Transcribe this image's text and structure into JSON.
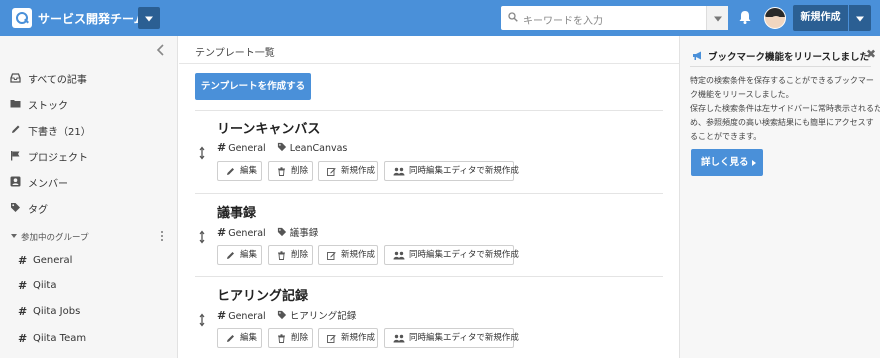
{
  "header": {
    "team_name": "サービス開発チーム",
    "search_placeholder": "キーワードを入力",
    "new_button": "新規作成",
    "accent": "#4a90d9",
    "dark_accent": "#2b5f93"
  },
  "sidebar": {
    "items": [
      {
        "label": "すべての記事",
        "icon": "inbox-icon"
      },
      {
        "label": "ストック",
        "icon": "folder-icon"
      },
      {
        "label": "下書き（21）",
        "icon": "pencil-icon"
      },
      {
        "label": "プロジェクト",
        "icon": "flag-icon"
      },
      {
        "label": "メンバー",
        "icon": "member-icon"
      },
      {
        "label": "タグ",
        "icon": "tag-icon"
      }
    ],
    "group_header": "参加中のグループ",
    "groups": [
      "General",
      "Qiita",
      "Qiita Jobs",
      "Qiita Team"
    ]
  },
  "main": {
    "title": "テンプレート一覧",
    "create_button": "テンプレートを作成する",
    "templates": [
      {
        "title": "リーンキャンバス",
        "group": "General",
        "tag": "LeanCanvas"
      },
      {
        "title": "議事録",
        "group": "General",
        "tag": "議事録"
      },
      {
        "title": "ヒアリング記録",
        "group": "General",
        "tag": "ヒアリング記録"
      }
    ],
    "actions": {
      "edit": "編集",
      "delete": "削除",
      "new": "新規作成",
      "coedit": "同時編集エディタで新規作成"
    }
  },
  "notice": {
    "title": "ブックマーク機能をリリースしました",
    "lines": [
      "特定の検索条件を保存することができるブックマー",
      "ク機能をリリースしました。",
      "保存した検索条件は左サイドバーに常時表示されるた",
      "め、参照頻度の高い検索結果にも簡単にアクセスす",
      "ることができます。"
    ],
    "button": "詳しく見る"
  }
}
